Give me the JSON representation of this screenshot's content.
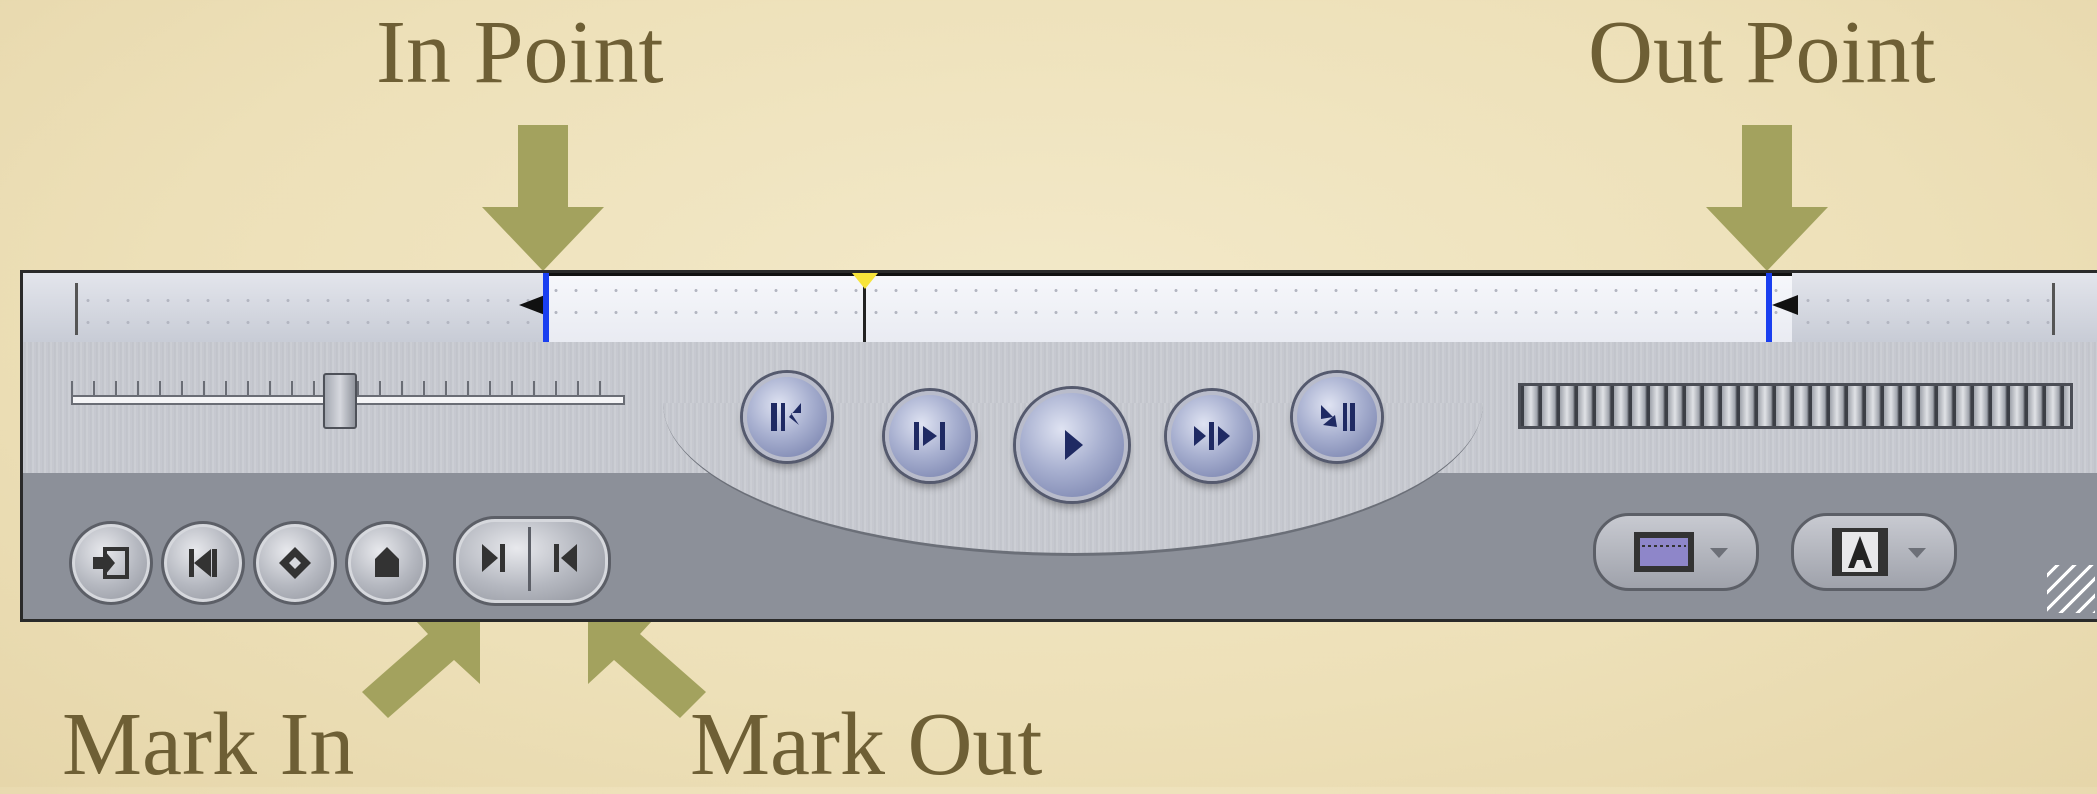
{
  "callouts": {
    "in_point": "In Point",
    "out_point": "Out Point",
    "mark_in": "Mark In",
    "mark_out": "Mark Out"
  },
  "colors": {
    "background": "#efe3bf",
    "callout_text": "#6e5f35",
    "arrow_fill": "#a3a25e",
    "in_out_marker": "#1a3ff0",
    "playhead": "#f7e43a"
  },
  "scrubber": {
    "in_point_fraction": 0.18,
    "out_point_fraction": 0.81,
    "playhead_fraction": 0.34
  },
  "shuttle": {
    "position_fraction": 0.5
  },
  "transport_buttons": [
    {
      "name": "go-to-in-point-button",
      "icon": "go-to-in-icon"
    },
    {
      "name": "play-in-to-out-button",
      "icon": "play-in-out-icon"
    },
    {
      "name": "play-button",
      "icon": "play-icon"
    },
    {
      "name": "play-around-current-button",
      "icon": "play-around-icon"
    },
    {
      "name": "go-to-out-point-button",
      "icon": "go-to-out-icon"
    }
  ],
  "marking_buttons": [
    {
      "name": "insert-edit-button",
      "icon": "insert-icon"
    },
    {
      "name": "match-frame-button",
      "icon": "match-frame-icon"
    },
    {
      "name": "add-keyframe-button",
      "icon": "keyframe-icon"
    },
    {
      "name": "add-marker-button",
      "icon": "marker-icon"
    },
    {
      "name": "mark-in-button",
      "icon": "mark-in-icon"
    },
    {
      "name": "mark-out-button",
      "icon": "mark-out-icon"
    }
  ],
  "popups": [
    {
      "name": "view-popup-button",
      "icon": "filmstrip-icon"
    },
    {
      "name": "generator-popup-button",
      "icon": "text-generator-icon"
    }
  ]
}
